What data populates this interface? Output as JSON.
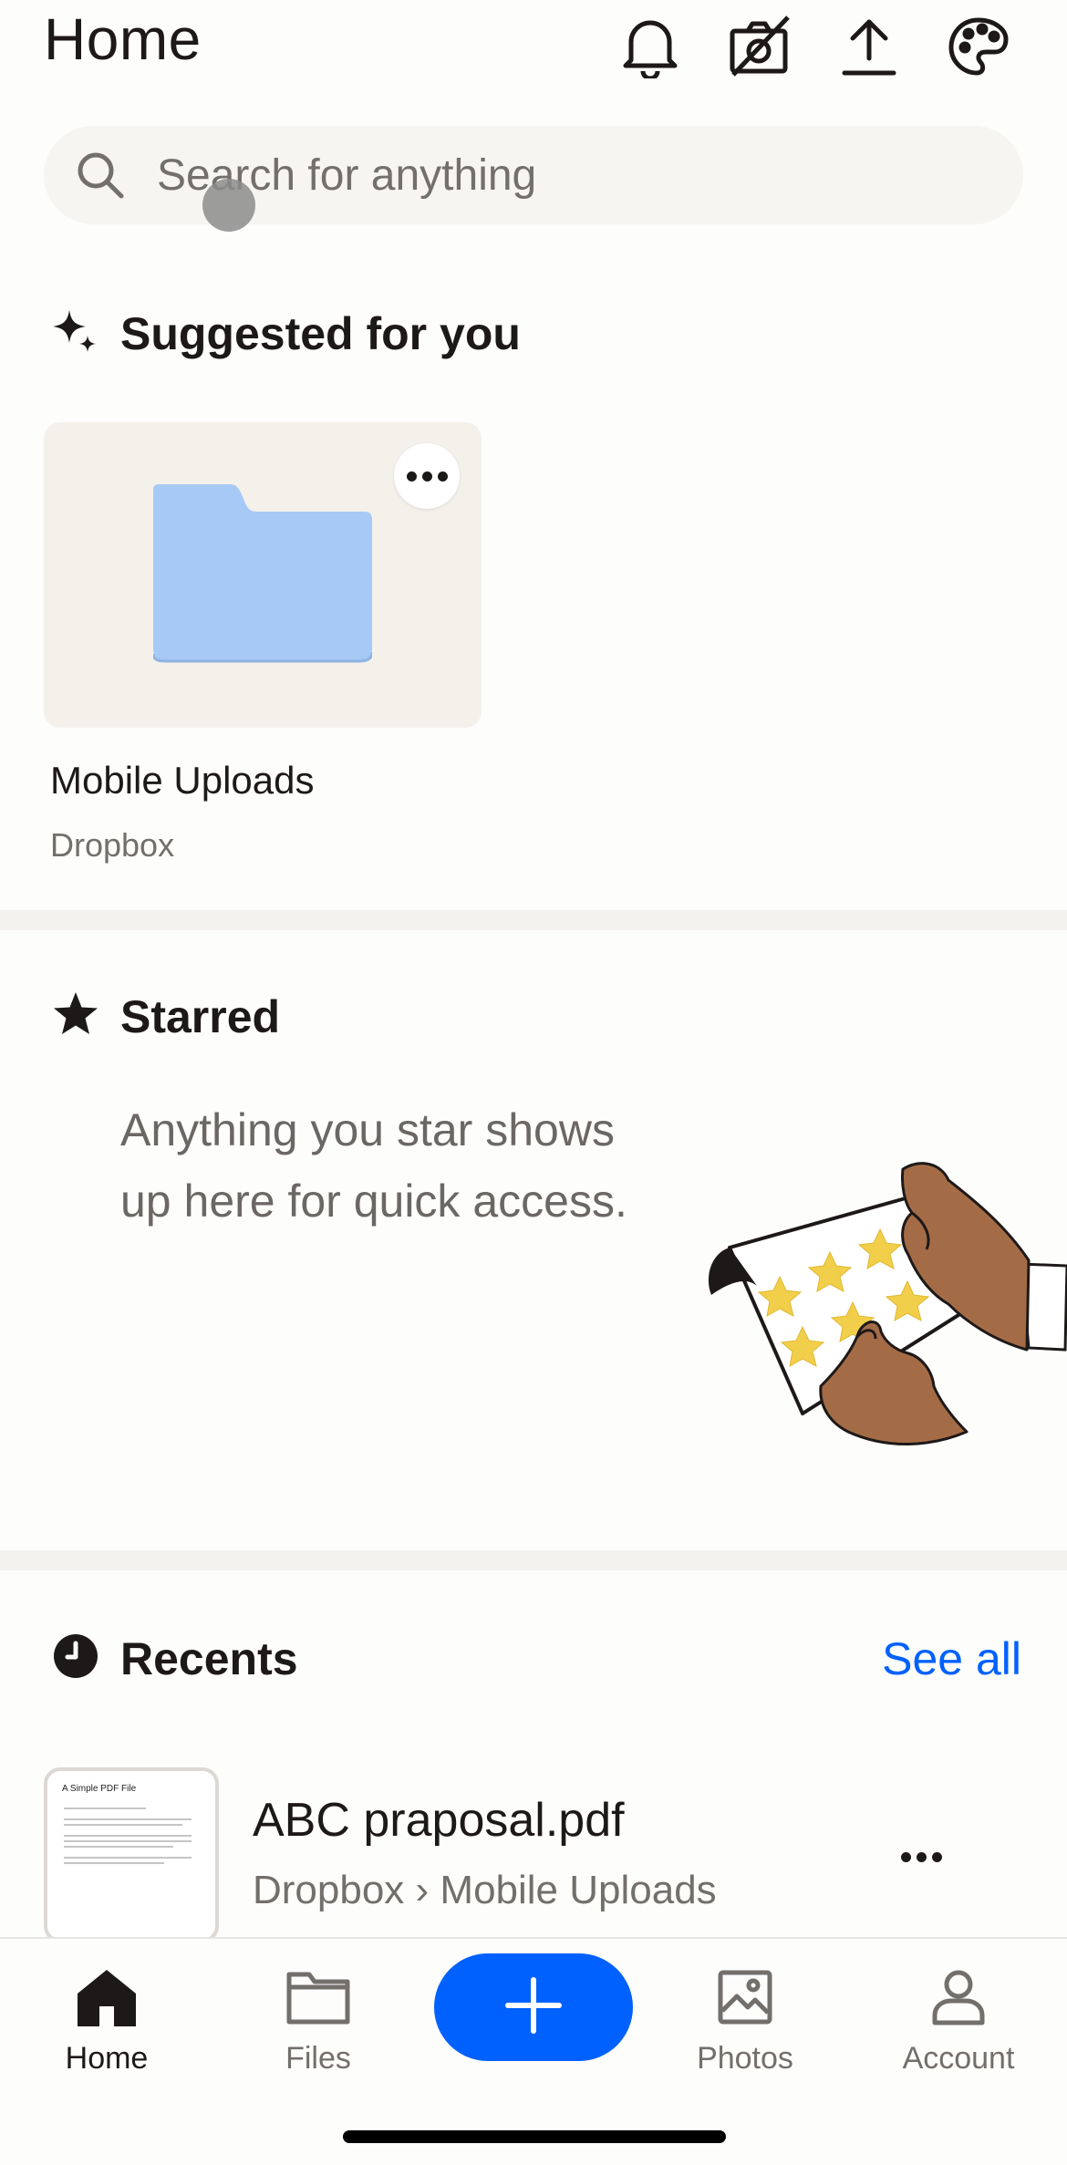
{
  "header": {
    "title": "Home",
    "icons": [
      "bell-icon",
      "camera-off-icon",
      "upload-icon",
      "palette-icon"
    ]
  },
  "search": {
    "placeholder": "Search for anything",
    "icon": "search-icon"
  },
  "suggested": {
    "heading": "Suggested for you",
    "icon": "sparkle-icon",
    "items": [
      {
        "name": "Mobile Uploads",
        "location": "Dropbox",
        "icon": "folder-icon",
        "folder_color": "#a7c9f5"
      }
    ]
  },
  "starred": {
    "heading": "Starred",
    "icon": "star-icon",
    "empty_message": "Anything you star shows up here for quick access."
  },
  "recents": {
    "heading": "Recents",
    "icon": "clock-icon",
    "see_all": "See all",
    "items": [
      {
        "name": "ABC praposal.pdf",
        "path": "Dropbox › Mobile Uploads",
        "thumb_title": "A Simple PDF File"
      }
    ]
  },
  "tabbar": {
    "tabs": [
      {
        "label": "Home",
        "icon": "home-icon",
        "active": true
      },
      {
        "label": "Files",
        "icon": "folder-icon",
        "active": false
      },
      {
        "label": "Photos",
        "icon": "photo-icon",
        "active": false
      },
      {
        "label": "Account",
        "icon": "person-icon",
        "active": false
      }
    ],
    "fab_icon": "plus-icon"
  },
  "colors": {
    "accent": "#0061fe",
    "text": "#1e1919",
    "muted": "#736f6b",
    "card_bg": "#f4f1eb",
    "folder": "#a7c9f5"
  }
}
